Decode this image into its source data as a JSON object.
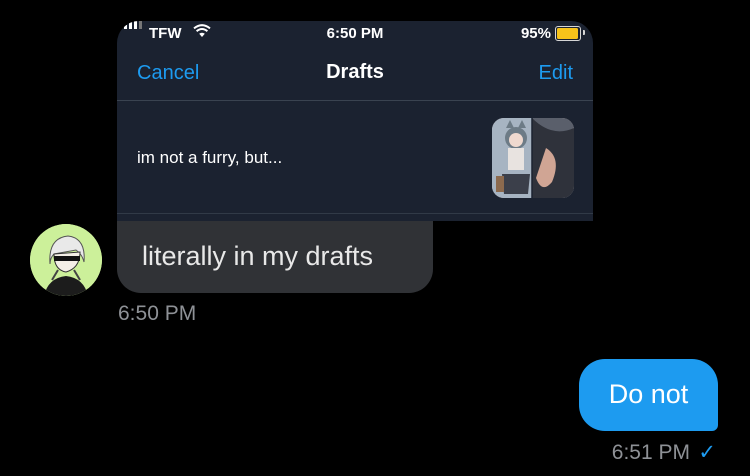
{
  "attachment": {
    "status_bar": {
      "carrier": "TFW",
      "time": "6:50 PM",
      "battery_percent": "95%",
      "battery_level": 0.95,
      "battery_color": "#f7c31a"
    },
    "nav": {
      "cancel_label": "Cancel",
      "title": "Drafts",
      "edit_label": "Edit"
    },
    "draft_text": "im not a furry, but..."
  },
  "received": {
    "text": "literally in my drafts",
    "timestamp": "6:50 PM"
  },
  "sent": {
    "text": "Do not",
    "timestamp": "6:51 PM",
    "status_icon": "check-icon"
  },
  "colors": {
    "accent": "#1d9bf0",
    "background": "#000000",
    "received_bubble": "#303236",
    "sent_bubble": "#1d9bf0",
    "avatar_bg": "#ccf09a"
  }
}
